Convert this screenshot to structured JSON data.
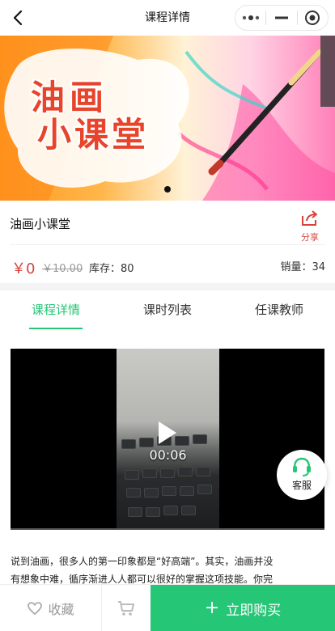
{
  "navbar": {
    "title": "课程详情",
    "back_icon": "chevron-left-icon",
    "menu_icon": "more-dots-icon",
    "minimize_icon": "minus-icon",
    "close_icon": "target-icon"
  },
  "banner": {
    "title_line1": "油画",
    "title_line2": "小课堂",
    "current_slide": 1,
    "total_slides": 1
  },
  "course": {
    "name": "油画小课堂",
    "share_label": "分享",
    "price": "￥0",
    "original_price": "￥10.00",
    "stock": "库存：80",
    "sales": "销量：34"
  },
  "tabs": [
    {
      "label": "课程详情",
      "active": true
    },
    {
      "label": "课时列表",
      "active": false
    },
    {
      "label": "任课教师",
      "active": false
    }
  ],
  "video": {
    "time": "00:06"
  },
  "description": {
    "line1": "说到油画，很多人的第一印象都是“好高端”。其实，油画并没",
    "line2": "有想象中难，循序渐进人人都可以很好的掌握这项技能。你完"
  },
  "service": {
    "label": "客服"
  },
  "bottom_bar": {
    "favorite_label": "收藏",
    "buy_label": "立即购买"
  },
  "colors": {
    "accent_green": "#25c676",
    "price_red": "#d9423b"
  }
}
